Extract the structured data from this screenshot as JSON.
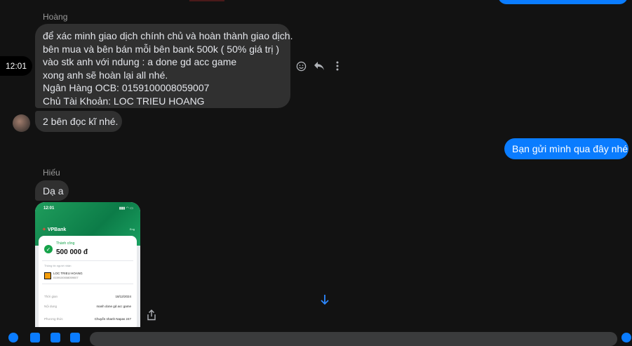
{
  "messages": {
    "hoang": {
      "sender": "Hoàng",
      "lines": [
        "để xác minh giao dịch chính chủ và hoàn thành giao dịch.",
        "bên mua và bên bán mỗi bên bank 500k ( 50% giá trị )",
        "vào stk anh với ndung : a done gd acc game",
        "xong anh sẽ hoàn lại all nhé.",
        "Ngân Hàng OCB: 0159100008059007",
        "Chủ Tài Khoản: LOC TRIEU HOANG"
      ],
      "followup": "2 bên đọc kĩ nhé.",
      "time": "12:01"
    },
    "sent": {
      "text": "Bạn gửi mình qua đây nhé"
    },
    "hieu": {
      "sender": "Hiếu",
      "text": "Dạ a"
    }
  },
  "receipt": {
    "status_time": "12:01",
    "bank": "VPBank",
    "lang": "Eng",
    "status": "Thành công",
    "amount": "500 000 đ",
    "recipient_label": "Thông tin người nhận",
    "recipient_name": "LOC TRIEU HOANG",
    "recipient_account": "0159100008059007",
    "rows": [
      {
        "label": "Thời gian",
        "value": "18/12/2024"
      },
      {
        "label": "Nội dung",
        "value": "manh done gd acc game"
      },
      {
        "label": "Phương thức",
        "value": "Chuyển nhanh Napas 247"
      }
    ]
  },
  "icons": [
    "emoji-icon",
    "reply-icon",
    "more-icon",
    "share-icon",
    "scroll-down-icon"
  ],
  "colors": {
    "accent": "#0a7cff",
    "bubble": "#303030",
    "background": "#121212"
  }
}
